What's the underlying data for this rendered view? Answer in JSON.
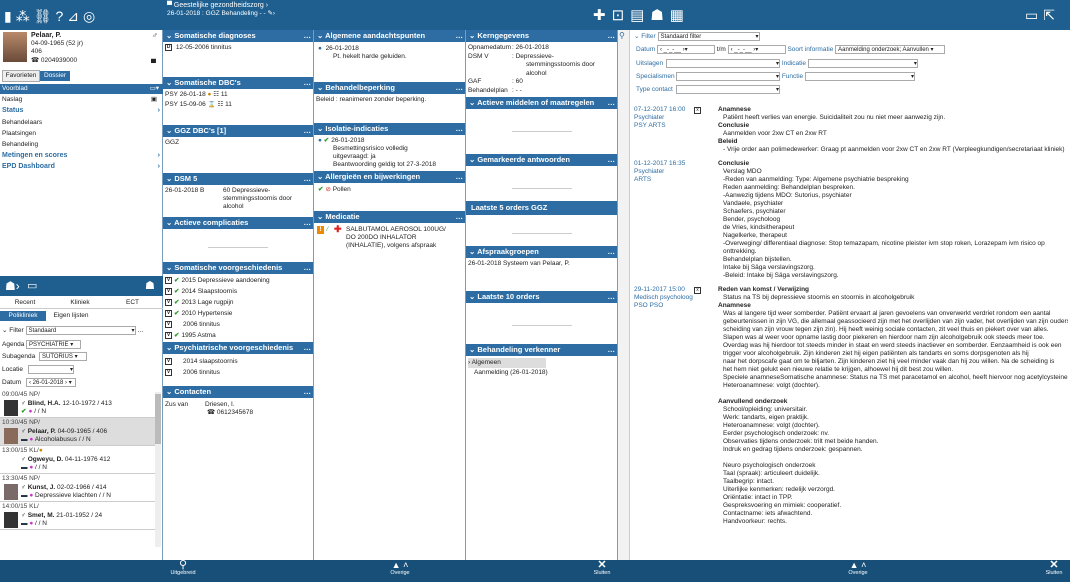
{
  "topbar": {
    "window_title": "Geestelijke gezondheidszorg",
    "subtitle": "26-01-2018 : GGZ Behandeling  - -"
  },
  "patient": {
    "name": "Pelaar, P.",
    "dob": "04-09-1965 (52 jr)",
    "room": "406",
    "id": "0204939000"
  },
  "left_tabs": [
    "Favorieten",
    "Dossier"
  ],
  "nav": [
    {
      "label": "Voorblad",
      "active": true
    },
    {
      "label": "Naslag"
    },
    {
      "label": "Status",
      "bold": true
    },
    {
      "label": "Behandelaars"
    },
    {
      "label": "Plaatsingen"
    },
    {
      "label": "Behandeling"
    },
    {
      "label": "Metingen en scores",
      "bold": true
    },
    {
      "label": "EPD Dashboard",
      "bold": true
    }
  ],
  "list": {
    "tabs1": [
      "Recent",
      "Kliniek",
      "ECT"
    ],
    "tabs2": [
      "Polikliniek",
      "Eigen lijsten"
    ],
    "filter_label": "Filter",
    "filter_value": "Standaard",
    "agenda_label": "Agenda",
    "agenda_value": "PSYCHIATRIE",
    "subagenda_label": "Subagenda",
    "subagenda_value": "SUTORIUS",
    "locatie_label": "Locatie",
    "datum_label": "Datum",
    "datum_value": "26-01-2018",
    "appointments": [
      {
        "time": "09:00/45 NP/",
        "name": "Blind, H.A.",
        "info": "12-10-1972 / 413",
        "sub": "/ / N"
      },
      {
        "time": "10:30/45 NP/",
        "name": "Pelaar, P.",
        "info": "04-09-1965 / 406",
        "sub": "Alcoholabusus / / N",
        "selected": true
      },
      {
        "time": "13:00/15 KL/",
        "name": "Ogweyu, D.",
        "info": "04-11-1976 412",
        "sub": "/ / N"
      },
      {
        "time": "13:30/45 NP/",
        "name": "Kunst, J.",
        "info": "02-02-1966 / 414",
        "sub": "Depressieve klachten / / N"
      },
      {
        "time": "14:00/15 KL/",
        "name": "Smet, M.",
        "info": "21-01-1952 / 24",
        "sub": "/ / N"
      }
    ]
  },
  "bottom": {
    "search_label": "Uitgebreid",
    "overige_label": "Overige",
    "sluiten_label": "Sluiten"
  },
  "col2": {
    "somatische_diagnoses": {
      "title": "Somatische diagnoses",
      "rows": [
        {
          "date": "12-05-2006",
          "text": "tinnitus"
        }
      ]
    },
    "somatische_dbcs": {
      "title": "Somatische DBC's",
      "rows": [
        {
          "text": "PSY  26-01-18",
          "num": "11"
        },
        {
          "text": "PSY  15-09-06",
          "num": "11"
        }
      ]
    },
    "ggz_dbcs": {
      "title": "GGZ DBC's [1]",
      "rows": [
        "GGZ"
      ]
    },
    "dsm5": {
      "title": "DSM 5",
      "date": "26-01-2018 B",
      "text": "60 Depressieve-stemmingsstoornis door alcohol"
    },
    "actieve_complicaties": {
      "title": "Actieve complicaties"
    },
    "voorgeschiedenis": {
      "title": "Somatische voorgeschiedenis",
      "rows": [
        "2015 Depressieve aandoening",
        "2014 Slaapstoornis",
        "2013 Lage rugpijn",
        "2010   Hypertensie",
        "2006 tinnitus",
        "1995 Astma"
      ]
    },
    "psych": {
      "title": "Psychiatrische voorgeschiedenis",
      "rows": [
        "2014 slaapstoornis",
        "2006 tinnitus"
      ]
    },
    "contacten": {
      "title": "Contacten",
      "relation": "Zus van",
      "name": "Driesen, I.",
      "phone": "0612345678"
    }
  },
  "col3": {
    "aandachtspunten": {
      "title": "Algemene aandachtspunten",
      "date": "26-01-2018",
      "text": "Pt. hekelt harde geluiden."
    },
    "behandelbeperking": {
      "title": "Behandelbeperking",
      "text": "Beleid : reanimeren zonder beperking."
    },
    "isolatie": {
      "title": "Isolatie-indicaties",
      "date": "26-01-2018",
      "lines": [
        "Besmettingsrisico volledig",
        "uitgevraagd: ja",
        "Beantwoording geldig tot 27-3-2018"
      ]
    },
    "allergie": {
      "title": "Allergieën en bijwerkingen",
      "item": "Pollen"
    },
    "medicatie": {
      "title": "Medicatie",
      "lines": [
        "SALBUTAMOL AEROSOL 100UG/",
        "DO 200DO INHALATOR",
        "(INHALATIE), volgens afspraak"
      ]
    }
  },
  "col4": {
    "kerngegevens": {
      "title": "Kerngegevens",
      "rows": [
        {
          "k": "Opnamedatum",
          "v": ": 26-01-2018"
        },
        {
          "k": "DSM V",
          "v": ":    Depressieve-"
        },
        {
          "k": "",
          "v": "stemmingsstoornis door"
        },
        {
          "k": "",
          "v": "alcohol"
        },
        {
          "k": "GAF",
          "v": ": 60"
        },
        {
          "k": "Behandelplan",
          "v": ":  -  -"
        }
      ]
    },
    "maatregelen": {
      "title": "Actieve middelen of maatregelen"
    },
    "antwoorden": {
      "title": "Gemarkeerde antwoorden"
    },
    "orders_ggz": {
      "title": "Laatste 5 orders GGZ"
    },
    "afspraak": {
      "title": "Afspraakgroepen",
      "text": "26-01-2018 Systeem van Pelaar, P."
    },
    "orders10": {
      "title": "Laatste 10 orders"
    },
    "verkenner": {
      "title": "Behandeling verkenner",
      "items": [
        "Algemeen",
        "Aanmelding (26-01-2018)"
      ]
    }
  },
  "right": {
    "filter_label": "Filter",
    "filter_value": "Standaard filter",
    "datum_label": "Datum",
    "tm_label": "t/m",
    "soort_label": "Soort informatie",
    "soort_value": "Aanmelding onderzoek; Aanvullen",
    "uitslagen_label": "Uitslagen",
    "indicatie_label": "Indicatie",
    "specialismen_label": "Specialismen",
    "functie_label": "Functie",
    "type_label": "Type contact",
    "entries": [
      {
        "date": "07-12-2017 16:00",
        "role1": "Psychiater",
        "role2": "PSY ARTS",
        "lines": [
          {
            "t": "Anamnese",
            "b": true
          },
          {
            "t": "Patiënt heeft verlies van energie. Suicidaliteit zou nu niet meer aanwezig zijn.",
            "i": true
          },
          {
            "t": "Conclusie",
            "b": true
          },
          {
            "t": "Aanmelden voor 2xw CT en 2xw RT",
            "i": true
          },
          {
            "t": "Beleid",
            "b": true
          },
          {
            "t": "- Vrije order aan polimedewerker: Graag pt aanmelden voor 2xw CT en 2xw RT (Verpleegkundigen/secretariaat kliniek)",
            "i": true
          }
        ]
      },
      {
        "date": "01-12-2017 16:35",
        "role1": "Psychiater",
        "role2": "ARTS",
        "lines": [
          {
            "t": "Conclusie",
            "b": true
          },
          {
            "t": "Verslag MDO",
            "i": true
          },
          {
            "t": "-Reden van aanmelding: Type: Algemene psychiatrie bespreking",
            "i": true
          },
          {
            "t": "Reden aanmelding: Behandelplan bespreken.",
            "i": true
          },
          {
            "t": "-Aanwezig tijdens MDO: Sutorius, psychiater",
            "i": true
          },
          {
            "t": "Vandaele, psychiater",
            "i": true
          },
          {
            "t": "Schaefers, psychiater",
            "i": true
          },
          {
            "t": "Bender, psycholoog",
            "i": true
          },
          {
            "t": "de Vries, kindsitherapeut",
            "i": true
          },
          {
            "t": "Nagelkerke, therapeut",
            "i": true
          },
          {
            "t": "-Overweging/ differentiaal diagnose: Stop temazapam, nicotine pleister ivm stop roken, Lorazepam ivm risico op",
            "i": true
          },
          {
            "t": "onttrekking.",
            "i": true
          },
          {
            "t": "Behandelplan bijstellen.",
            "i": true
          },
          {
            "t": "Intake bij Säga verslavingszorg.",
            "i": true
          },
          {
            "t": "-Beleid: Intake bij Säga verslavingszorg.",
            "i": true
          }
        ]
      },
      {
        "date": "29-11-2017 15:00",
        "role1": "Medisch psycholoog",
        "role2": "PSO PSO",
        "lines": [
          {
            "t": "Reden van komst / Verwijzing",
            "b": true
          },
          {
            "t": "Status na TS bij depressieve stoornis en stoornis in alcoholgebruik",
            "i": true
          },
          {
            "t": "Anamnese",
            "b": true
          },
          {
            "t": "Was al langere tijd weer somberder. Patiënt ervaart al jaren gevoelens van onverwerkt verdriet rondom een aantal",
            "i": true
          },
          {
            "t": "gebeurtenissen in zijn VG, die allemaal geassocieerd zijn met het overlijden van zijn vader, het overlijden van zijn ouders,",
            "i": true
          },
          {
            "t": "scheiding van zijn vrouw tegen zijn zin). Hij heeft weinig sociale contacten, zit veel thuis en piekert over van alles.",
            "i": true
          },
          {
            "t": "Slapen was al weer voor opname lastig door piekeren en hierdoor nam zijn alcoholgebruik ook steeds meer toe.",
            "i": true
          },
          {
            "t": "Overdag was hij hierdoor tot steeds minder in staat en werd steeds inactiever en somberder. Eenzaamheid is ook een",
            "i": true
          },
          {
            "t": "trigger voor alcoholgebruik. Zijn kinderen ziet hij eigen patiënten als tandarts en soms dorpsgenoten als hij",
            "i": true
          },
          {
            "t": "naar het dorpscafe gaat om te biljarten. Zijn kinderen ziet hij veel minder vaak dan hij zou willen. Na de scheiding is",
            "i": true
          },
          {
            "t": "het hem niet gelukt een nieuwe relatie te krijgen, alhoewel hij dit best zou willen.",
            "i": true
          },
          {
            "t": "Speciele anamneseSomatische anamnese: Status na TS met paracetamol en alcohol, heeft hiervoor nog acetylcysteine.",
            "i": true
          },
          {
            "t": "Heteroanamnese: volgt (dochter).",
            "i": true
          },
          {
            "t": "",
            "i": true
          },
          {
            "t": "Aanvullend onderzoek",
            "b": true
          },
          {
            "t": "School/opleiding: universitair.",
            "i": true
          },
          {
            "t": "Werk: tandarts, eigen praktijk.",
            "i": true
          },
          {
            "t": "Heteroanamnese: volgt (dochter).",
            "i": true
          },
          {
            "t": "Eerder psychologisch onderzoek: nv.",
            "i": true
          },
          {
            "t": "Observaties tijdens onderzoek: trilt met beide handen.",
            "i": true
          },
          {
            "t": "Indruk en gedrag tijdens onderzoek: gespannen.",
            "i": true
          },
          {
            "t": "",
            "i": true
          },
          {
            "t": "Neuro psychologisch onderzoek",
            "i": true
          },
          {
            "t": "Taal (spraak): articuleert duidelijk.",
            "i": true
          },
          {
            "t": "Taalbegrip: intact.",
            "i": true
          },
          {
            "t": "Uiterlijke kenmerken: redelijk verzorgd.",
            "i": true
          },
          {
            "t": "Oriëntatie: intact in TPP.",
            "i": true
          },
          {
            "t": "Gespreksvoering en mimiek: cooperatief.",
            "i": true
          },
          {
            "t": "Contactname: iets afwachtend.",
            "i": true
          },
          {
            "t": "Handvoorkeur: rechts.",
            "i": true
          }
        ]
      }
    ]
  },
  "colors": {
    "nav_blue": "#1e5f8f",
    "panel_blue": "#2d6da3",
    "green": "#2a9a2a",
    "red": "#d22"
  }
}
